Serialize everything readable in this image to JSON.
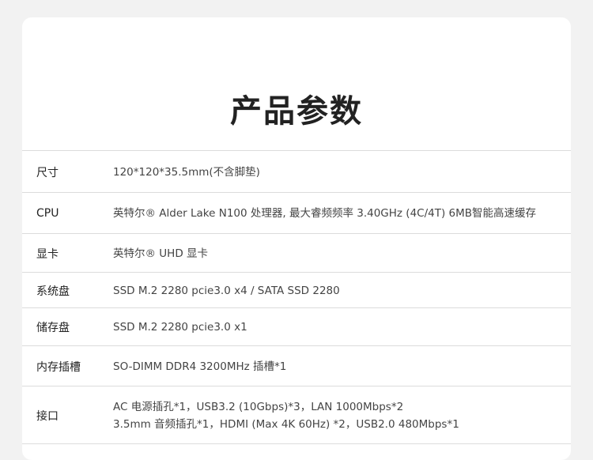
{
  "page_title": "产品参数",
  "specs": [
    {
      "label": "尺寸",
      "lines": [
        "120*120*35.5mm(不含脚垫)"
      ]
    },
    {
      "label": "CPU",
      "lines": [
        "英特尔® Alder Lake N100 处理器, 最大睿频频率 3.40GHz (4C/4T) 6MB智能高速缓存"
      ]
    },
    {
      "label": "显卡",
      "lines": [
        "英特尔® UHD 显卡"
      ]
    },
    {
      "label": "系统盘",
      "lines": [
        "SSD  M.2 2280 pcie3.0 x4 / SATA  SSD 2280"
      ]
    },
    {
      "label": "储存盘",
      "lines": [
        "SSD   M.2 2280 pcie3.0 x1"
      ]
    },
    {
      "label": "内存插槽",
      "lines": [
        "SO-DIMM DDR4 3200MHz 插槽*1"
      ]
    },
    {
      "label": "接口",
      "lines": [
        "AC 电源插孔*1，USB3.2 (10Gbps)*3，LAN 1000Mbps*2",
        "3.5mm 音频插孔*1，HDMI (Max 4K 60Hz) *2，USB2.0 480Mbps*1"
      ]
    }
  ]
}
